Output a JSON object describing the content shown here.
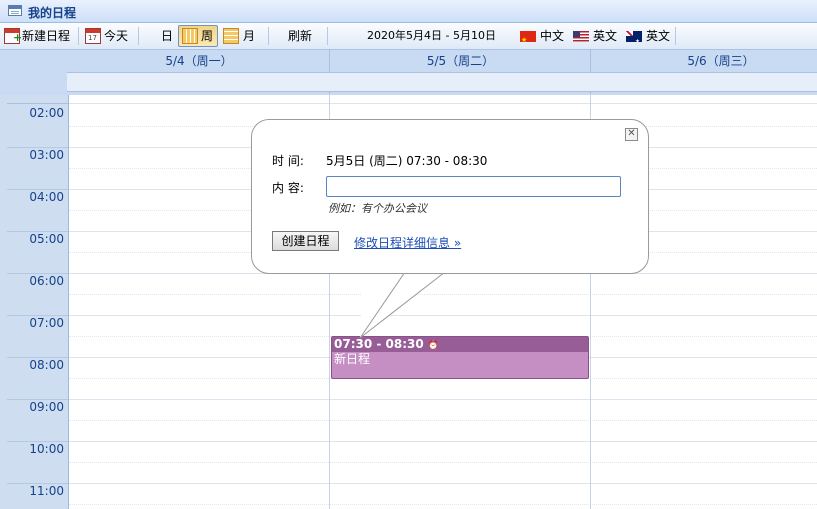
{
  "window": {
    "title": "我的日程"
  },
  "toolbar": {
    "new_label": "新建日程",
    "today_label": "今天",
    "day_label": "日",
    "week_label": "周",
    "month_label": "月",
    "refresh_label": "刷新",
    "date_range": "2020年5月4日 - 5月10日",
    "lang_cn": "中文",
    "lang_en_us": "英文",
    "lang_en_au": "英文"
  },
  "days": [
    "5/4（周一）",
    "5/5（周二）",
    "5/6（周三）"
  ],
  "times": [
    "02:00",
    "03:00",
    "04:00",
    "05:00",
    "06:00",
    "07:00",
    "08:00",
    "09:00",
    "10:00",
    "11:00"
  ],
  "event": {
    "time": "07:30 - 08:30",
    "title": "新日程",
    "color": "#c58fc4"
  },
  "popup": {
    "time_label": "时 间:",
    "time_value": "5月5日 (周二) 07:30 - 08:30",
    "content_label": "内 容:",
    "content_value": "",
    "hint": "例如：有个办公会议",
    "create_button": "创建日程",
    "detail_link": "修改日程详细信息 »"
  },
  "colors": {
    "header_bg": "#c9daf3",
    "accent": "#15428b"
  }
}
